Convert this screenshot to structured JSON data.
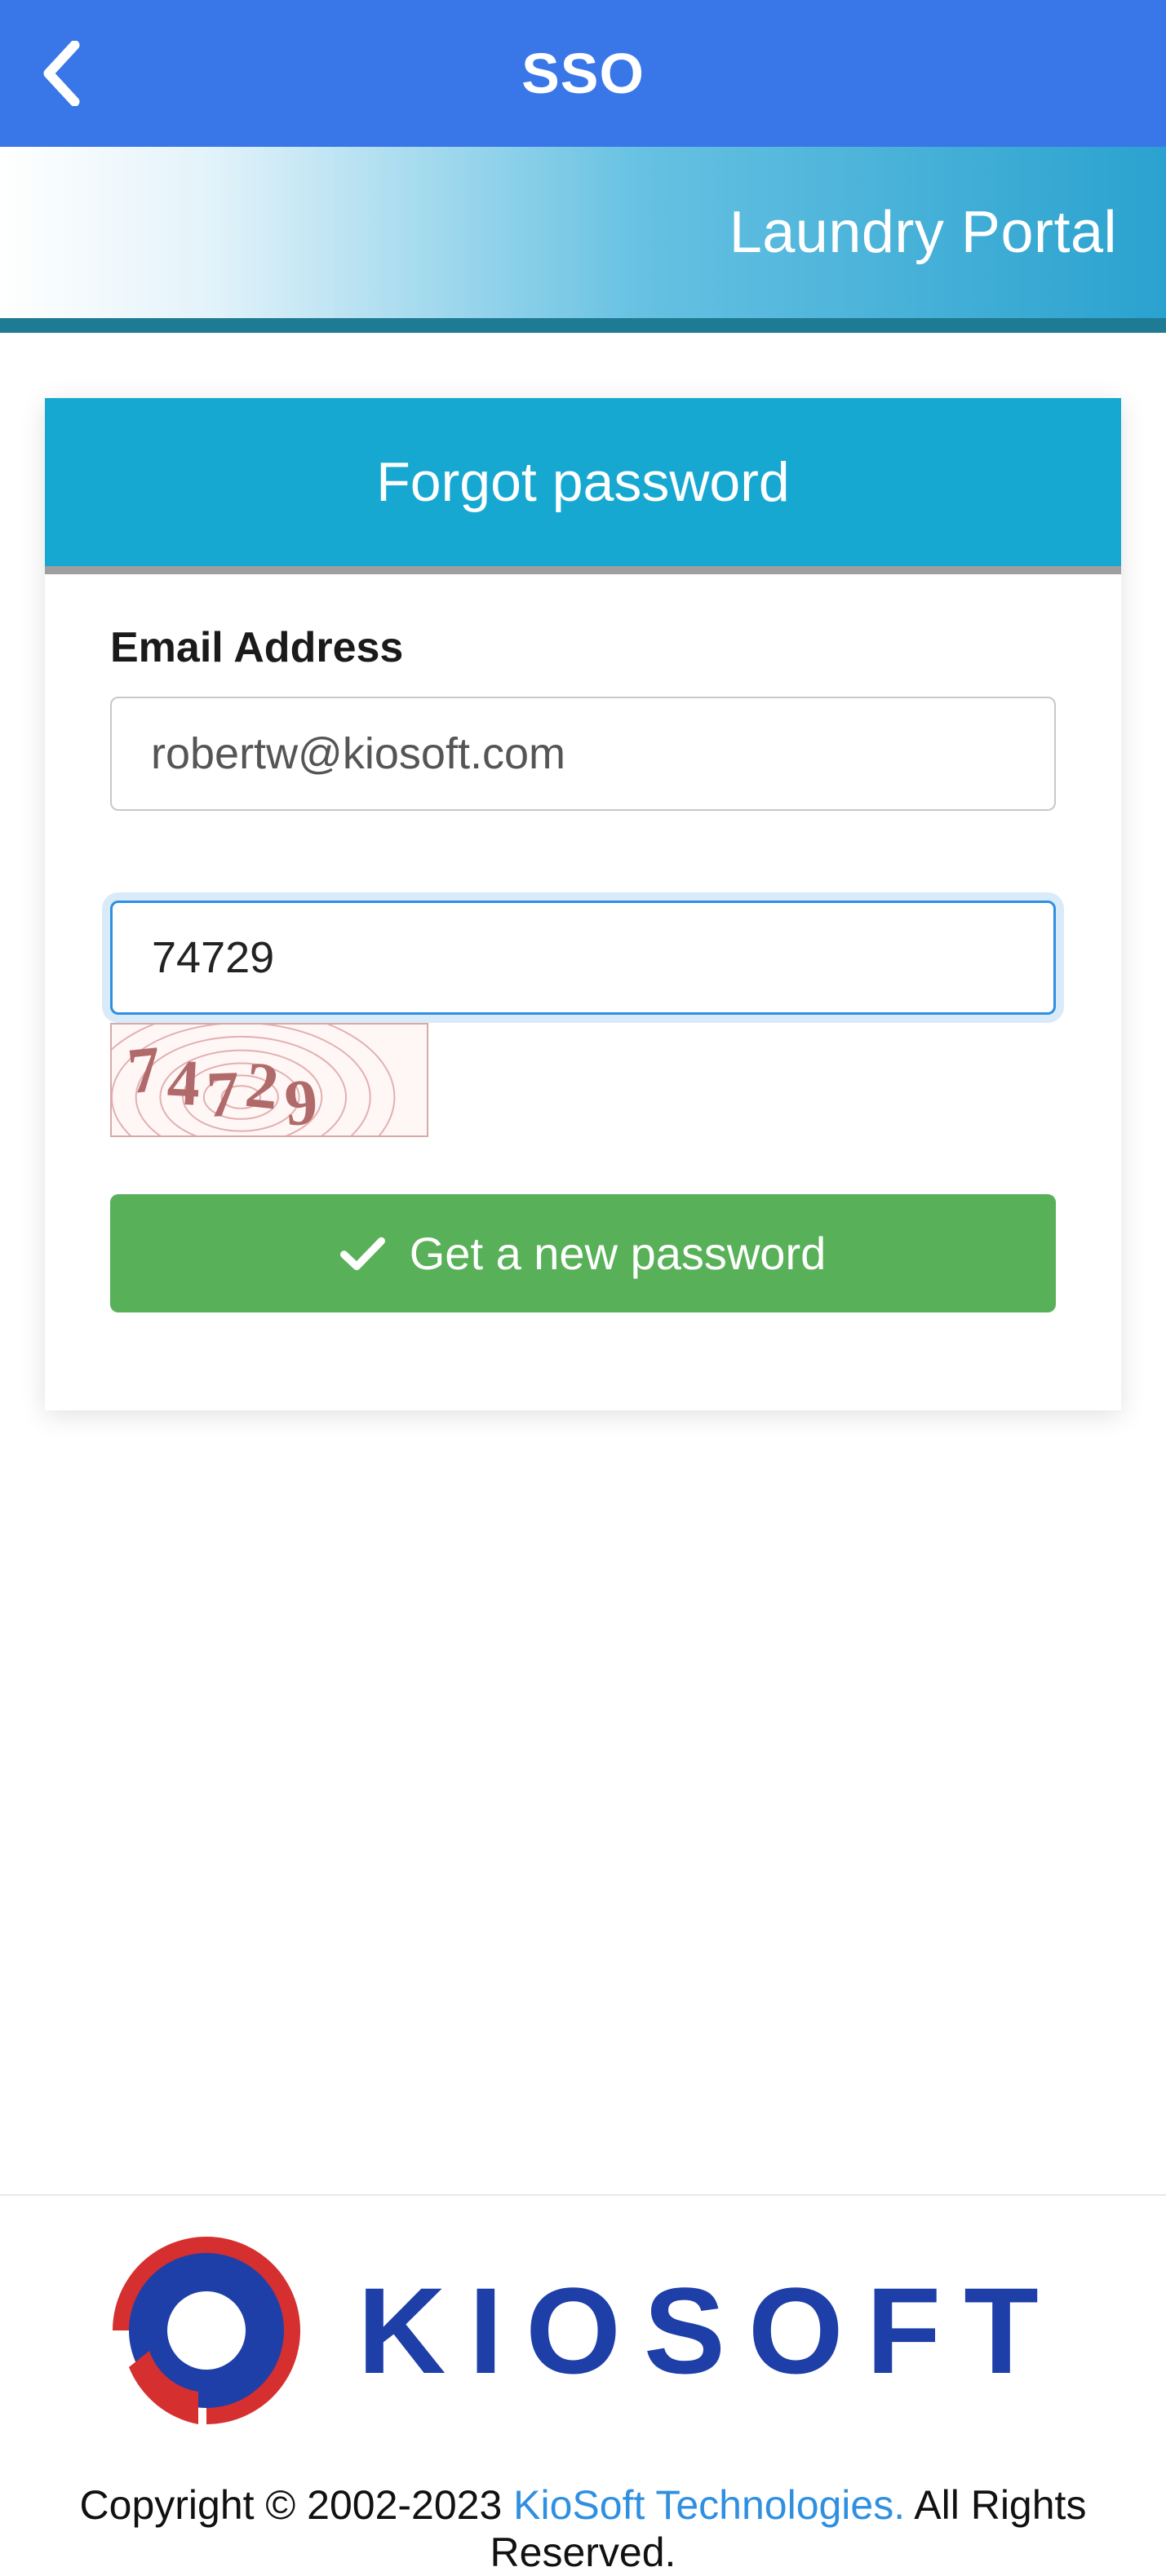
{
  "app_bar": {
    "title": "SSO"
  },
  "portal": {
    "title": "Laundry Portal"
  },
  "card": {
    "header": "Forgot password",
    "email_label": "Email Address",
    "email_value": "robertw@kiosoft.com",
    "captcha_value": "74729",
    "captcha_image_text": "74729",
    "submit_label": "Get a new password"
  },
  "footer": {
    "logo_text": "KIOSOFT",
    "copyright_prefix": "Copyright © 2002-2023 ",
    "company_link": "KioSoft Technologies.",
    "copyright_suffix": " All Rights Reserved."
  }
}
